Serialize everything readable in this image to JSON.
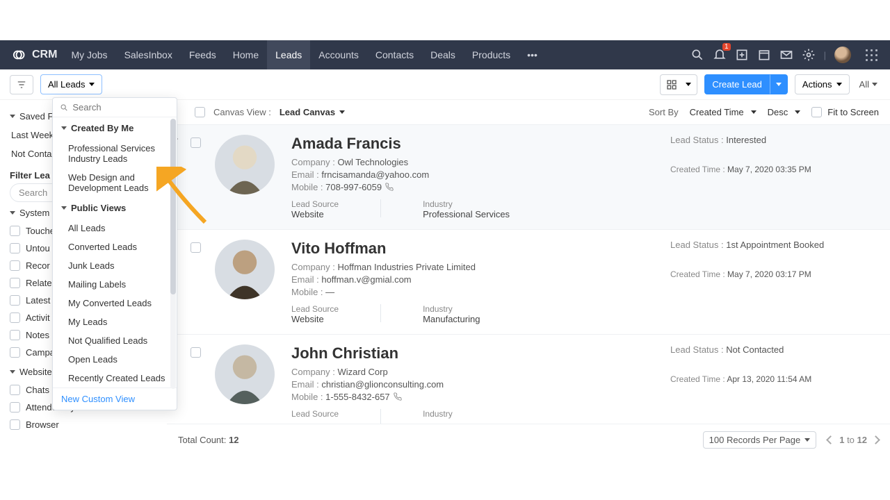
{
  "brand": "CRM",
  "nav": [
    "My Jobs",
    "SalesInbox",
    "Feeds",
    "Home",
    "Leads",
    "Accounts",
    "Contacts",
    "Deals",
    "Products"
  ],
  "nav_active": "Leads",
  "notif_badge": "1",
  "toolbar": {
    "all_leads": "All Leads",
    "create": "Create Lead",
    "actions": "Actions",
    "all": "All"
  },
  "view_popup": {
    "search_placeholder": "Search",
    "created_by_me": "Created By Me",
    "cbm_items": [
      "Professional Services Industry Leads",
      "Web Design and Development Leads"
    ],
    "public_views": "Public Views",
    "pv_items": [
      "All Leads",
      "Converted Leads",
      "Junk Leads",
      "Mailing Labels",
      "My Converted Leads",
      "My Leads",
      "Not Qualified Leads",
      "Open Leads",
      "Recently Created Leads"
    ],
    "new_custom": "New Custom View"
  },
  "sidebar": {
    "saved_filters": "Saved F",
    "saved_items": [
      "Last Week",
      "Not Conta"
    ],
    "filter_label": "Filter Lea",
    "search_placeholder": "Search",
    "system": "System",
    "system_items": [
      "Touche",
      "Untou",
      "Recor",
      "Relate",
      "Latest",
      "Activit",
      "Notes",
      "Campa"
    ],
    "website": "Website Activity",
    "website_items": [
      "Chats",
      "Attended By",
      "Browser"
    ]
  },
  "list_header": {
    "canvas_view": "Canvas View :",
    "canvas_name": "Lead Canvas",
    "sort_by": "Sort By",
    "sort_field": "Created Time",
    "sort_dir": "Desc",
    "fit": "Fit to Screen"
  },
  "cards": [
    {
      "name": "Amada Francis",
      "company_k": "Company :",
      "company": "Owl Technologies",
      "email_k": "Email :",
      "email": "frncisamanda@yahoo.com",
      "mobile_k": "Mobile :",
      "mobile": "708-997-6059",
      "source_k": "Lead Source",
      "source": "Website",
      "industry_k": "Industry",
      "industry": "Professional Services",
      "status_k": "Lead Status :",
      "status": "Interested",
      "ctime_k": "Created Time :",
      "ctime": "May 7, 2020 03:35 PM"
    },
    {
      "name": "Vito Hoffman",
      "company_k": "Company :",
      "company": "Hoffman Industries Private Limited",
      "email_k": "Email :",
      "email": "hoffman.v@gmial.com",
      "mobile_k": "Mobile :",
      "mobile": "—",
      "source_k": "Lead Source",
      "source": "Website",
      "industry_k": "Industry",
      "industry": "Manufacturing",
      "status_k": "Lead Status :",
      "status": "1st Appointment Booked",
      "ctime_k": "Created Time :",
      "ctime": "May 7, 2020 03:17 PM"
    },
    {
      "name": "John Christian",
      "company_k": "Company :",
      "company": "Wizard Corp",
      "email_k": "Email :",
      "email": "christian@glionconsulting.com",
      "mobile_k": "Mobile :",
      "mobile": "1-555-8432-657",
      "source_k": "Lead Source",
      "source": "",
      "industry_k": "Industry",
      "industry": "",
      "status_k": "Lead Status :",
      "status": "Not Contacted",
      "ctime_k": "Created Time :",
      "ctime": "Apr 13, 2020 11:54 AM"
    }
  ],
  "footer": {
    "total_k": "Total Count:",
    "total": "12",
    "records": "100 Records Per Page",
    "page_from": "1",
    "page_to": "12",
    "to": "to"
  }
}
